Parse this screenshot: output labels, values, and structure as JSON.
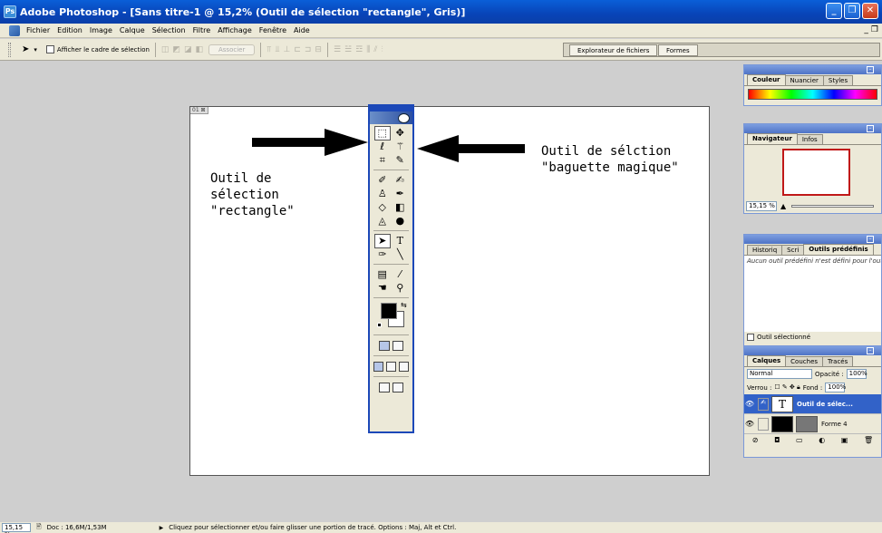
{
  "window": {
    "title": "Adobe Photoshop - [Sans titre-1 @ 15,2% (Outil de sélection \"rectangle\", Gris)]",
    "app_icon_text": "Ps"
  },
  "menu": {
    "items": [
      "Fichier",
      "Edition",
      "Image",
      "Calque",
      "Sélection",
      "Filtre",
      "Affichage",
      "Fenêtre",
      "Aide"
    ]
  },
  "options_bar": {
    "show_bounding_label": "Afficher le cadre de sélection",
    "associate_label": "Associer",
    "well_tabs": [
      "Explorateur de fichiers",
      "Formes"
    ]
  },
  "document": {
    "tag": "01 ⊠",
    "annotation_left": "Outil de\nsélection\n\"rectangle\"",
    "annotation_right": "Outil de sélction\n\"baguette magique\""
  },
  "palettes": {
    "color": {
      "tabs": [
        "Couleur",
        "Nuancier",
        "Styles"
      ]
    },
    "navigator": {
      "tabs": [
        "Navigateur",
        "Infos"
      ],
      "zoom": "15,15 %"
    },
    "presets": {
      "tabs": [
        "Historiq",
        "Scri",
        "Outils prédéfinis"
      ],
      "empty_text": "Aucun outil prédéfini n'est défini pour l'outil",
      "current_tool_label": "Outil sélectionné"
    },
    "layers": {
      "tabs": [
        "Calques",
        "Couches",
        "Tracés"
      ],
      "blend_mode": "Normal",
      "opacity_label": "Opacité :",
      "opacity_value": "100%",
      "lock_label": "Verrou :",
      "fill_label": "Fond :",
      "fill_value": "100%",
      "layers": [
        {
          "name": "Outil de sélec...",
          "selected": true
        },
        {
          "name": "Forme 4",
          "selected": false
        }
      ]
    }
  },
  "statusbar": {
    "zoom": "15,15 %",
    "doc": "Doc : 16,6M/1,53M",
    "hint": "Cliquez pour sélectionner et/ou faire glisser une portion de tracé. Options : Maj, Alt et Ctrl."
  },
  "colors": {
    "titlebar": "#0a5fd8",
    "workspace": "#cfcfcf",
    "toolbox_border": "#1c48b8",
    "selected_layer": "#3262c8"
  }
}
